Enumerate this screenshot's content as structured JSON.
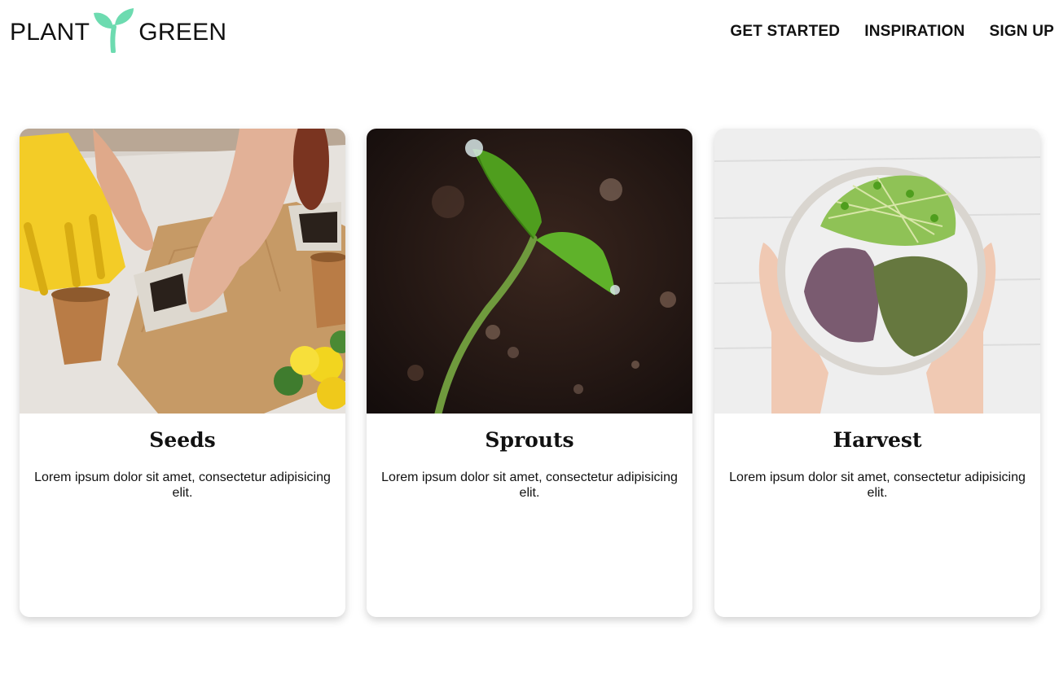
{
  "brand": {
    "word_left": "PLANT",
    "word_right": "GREEN",
    "sprout_icon": "sprout-icon",
    "accent_color": "#6ddbb0"
  },
  "nav": {
    "items": [
      {
        "label": "GET STARTED"
      },
      {
        "label": "INSPIRATION"
      },
      {
        "label": "SIGN UP"
      }
    ]
  },
  "cards": [
    {
      "title": "Seeds",
      "text": "Lorem ipsum dolor sit amet, consectetur adipisicing elit.",
      "image": "hands-planting-seeds-photo"
    },
    {
      "title": "Sprouts",
      "text": "Lorem ipsum dolor sit amet, consectetur adipisicing elit.",
      "image": "seedling-in-soil-photo"
    },
    {
      "title": "Harvest",
      "text": "Lorem ipsum dolor sit amet, consectetur adipisicing elit.",
      "image": "bowl-of-microgreens-photo"
    }
  ]
}
